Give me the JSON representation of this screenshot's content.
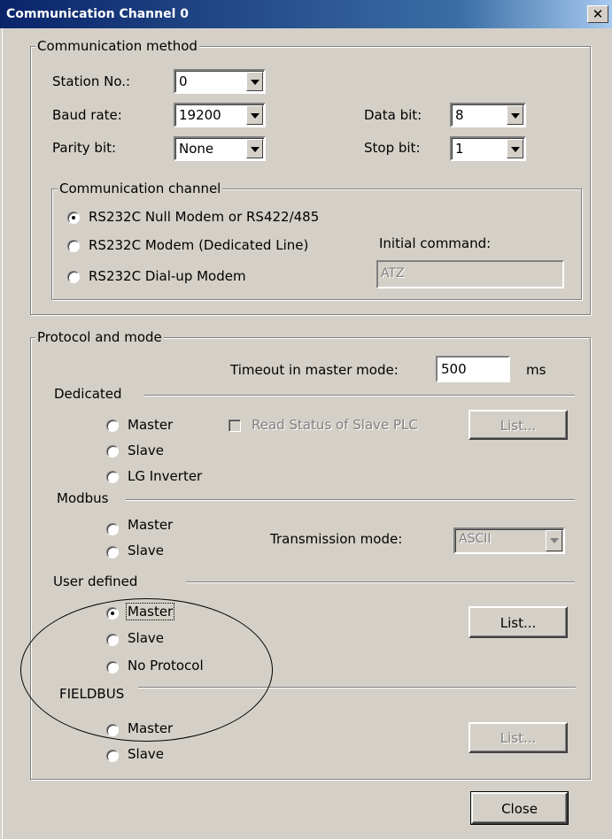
{
  "window": {
    "title": "Communication Channel 0",
    "close_glyph": "✕"
  },
  "comm_method": {
    "legend": "Communication method",
    "station_label": "Station No.:",
    "station_value": "0",
    "baud_label": "Baud rate:",
    "baud_value": "19200",
    "databit_label": "Data bit:",
    "databit_value": "8",
    "parity_label": "Parity bit:",
    "parity_value": "None",
    "stopbit_label": "Stop bit:",
    "stopbit_value": "1",
    "channel": {
      "legend": "Communication channel",
      "options": [
        {
          "label": "RS232C Null Modem or RS422/485",
          "selected": true
        },
        {
          "label": "RS232C Modem (Dedicated Line)",
          "selected": false
        },
        {
          "label": "RS232C Dial-up Modem",
          "selected": false
        }
      ],
      "initial_command_label": "Initial command:",
      "initial_command_value": "ATZ"
    }
  },
  "protocol": {
    "legend": "Protocol and mode",
    "timeout_label": "Timeout in master mode:",
    "timeout_value": "500",
    "timeout_unit": "ms",
    "dedicated": {
      "label": "Dedicated",
      "options": [
        "Master",
        "Slave",
        "LG Inverter"
      ],
      "read_status_label": "Read Status of Slave PLC",
      "list_label": "List..."
    },
    "modbus": {
      "label": "Modbus",
      "options": [
        "Master",
        "Slave"
      ],
      "transmission_label": "Transmission mode:",
      "transmission_value": "ASCII"
    },
    "user_defined": {
      "label": "User defined",
      "options": [
        "Master",
        "Slave",
        "No Protocol"
      ],
      "selected": "Master",
      "list_label": "List..."
    },
    "fieldbus": {
      "label": "FIELDBUS",
      "options": [
        "Master",
        "Slave"
      ],
      "list_label": "List..."
    }
  },
  "footer": {
    "close_label": "Close"
  }
}
